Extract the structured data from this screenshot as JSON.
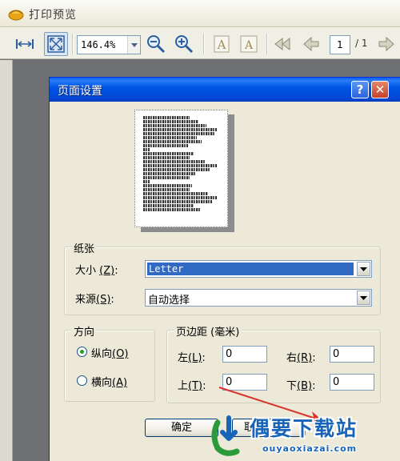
{
  "app": {
    "title": "打印预览",
    "zoom": "146.4%",
    "page_current": "1",
    "page_total": "/ 1"
  },
  "dialog": {
    "title": "页面设置",
    "help_label": "?",
    "close_label": "✕",
    "paper": {
      "legend": "纸张",
      "size_label": "大小",
      "size_key": "(Z)",
      "size_value": "Letter",
      "source_label": "来源",
      "source_key": "(S)",
      "source_value": "自动选择"
    },
    "orientation": {
      "legend": "方向",
      "portrait_label": "纵向",
      "portrait_key": "(O)",
      "landscape_label": "横向",
      "landscape_key": "(A)",
      "selected": "portrait"
    },
    "margins": {
      "legend": "页边距 (毫米)",
      "left_label": "左",
      "left_key": "(L)",
      "left_value": "0",
      "right_label": "右",
      "right_key": "(R)",
      "right_value": "0",
      "top_label": "上",
      "top_key": "(T)",
      "top_value": "0",
      "bottom_label": "下",
      "bottom_key": "(B)",
      "bottom_value": "0"
    },
    "buttons": {
      "ok_label": "确定",
      "cancel_label": "取"
    }
  },
  "watermark": {
    "text": "偶要下载站",
    "url": "ouyaoxiazai.com"
  },
  "colors": {
    "dialog_title_bar": "#0055e5",
    "selection": "#316ac5",
    "close_button": "#c4412a",
    "watermark": "#1764b8",
    "annotation_arrow": "#d9342a"
  }
}
